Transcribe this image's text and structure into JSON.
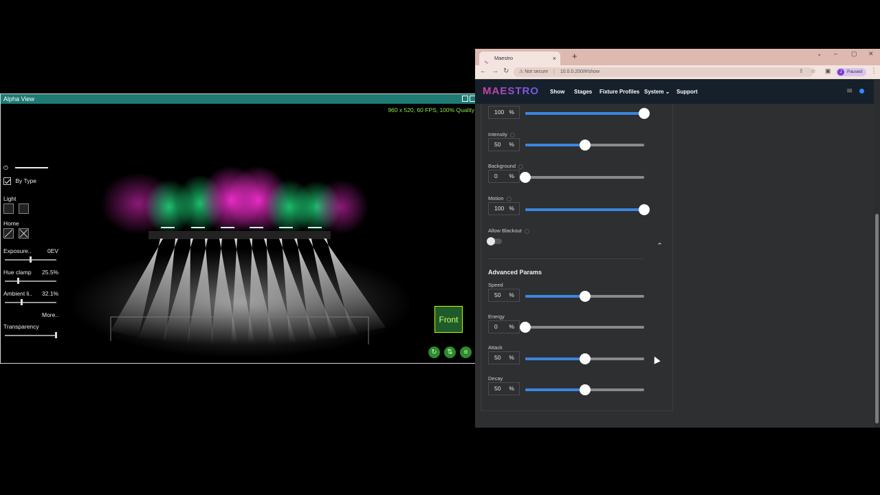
{
  "alpha": {
    "title": "Alpha View",
    "stats": "960 x 520, 60 FPS, 100% Quality",
    "by_type": "By Type",
    "light": "Light",
    "home": "Home",
    "exposure_label": "Exposure..",
    "exposure_value": "0EV",
    "hue_label": "Hue clamp",
    "hue_value": "25.5%",
    "ambient_label": "Ambient li..",
    "ambient_value": "32.1%",
    "more": "More..",
    "transparency": "Transparency",
    "front": "Front"
  },
  "browser": {
    "tab_title": "Maestro",
    "not_secure": "Not secure",
    "url": "10.0.0.200/#/show",
    "profile_initial": "J",
    "profile_status": "Paused"
  },
  "app": {
    "logo": "MAESTRO",
    "nav": [
      "Show",
      "Stages",
      "Fixture Profiles",
      "System ⌄",
      "Support"
    ]
  },
  "params": {
    "pct_symbol": "%",
    "first": {
      "value": "100",
      "fill": 1.0
    },
    "intensity": {
      "label": "Intensity",
      "value": "50",
      "fill": 0.5
    },
    "background": {
      "label": "Background",
      "value": "0",
      "fill": 0.0
    },
    "motion": {
      "label": "Motion",
      "value": "100",
      "fill": 1.0
    },
    "allow_blackout": "Allow Blackout",
    "advanced_title": "Advanced Params",
    "speed": {
      "label": "Speed",
      "value": "50",
      "fill": 0.5
    },
    "energy": {
      "label": "Energy",
      "value": "0",
      "fill": 0.0
    },
    "attack": {
      "label": "Attack",
      "value": "50",
      "fill": 0.5
    },
    "decay": {
      "label": "Decay",
      "value": "50",
      "fill": 0.5
    }
  }
}
